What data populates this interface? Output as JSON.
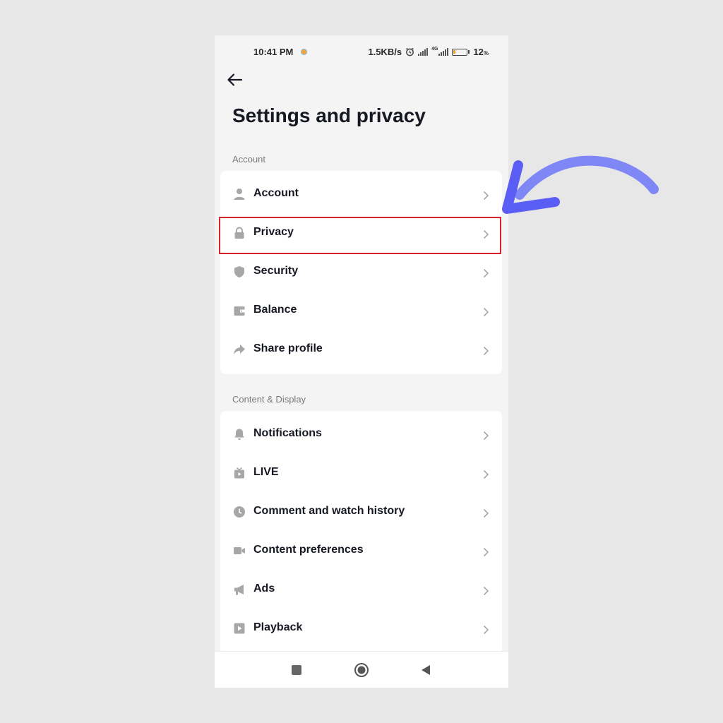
{
  "status": {
    "time": "10:41 PM",
    "speed": "1.5KB/s",
    "network": "4G",
    "battery": "12",
    "battery_unit": "%"
  },
  "header": {
    "title": "Settings and privacy"
  },
  "sections": [
    {
      "label": "Account",
      "items": [
        {
          "label": "Account",
          "icon": "person-icon"
        },
        {
          "label": "Privacy",
          "icon": "lock-icon"
        },
        {
          "label": "Security",
          "icon": "shield-icon"
        },
        {
          "label": "Balance",
          "icon": "wallet-icon"
        },
        {
          "label": "Share profile",
          "icon": "share-icon"
        }
      ]
    },
    {
      "label": "Content & Display",
      "items": [
        {
          "label": "Notifications",
          "icon": "bell-icon"
        },
        {
          "label": "LIVE",
          "icon": "live-tv-icon"
        },
        {
          "label": "Comment and watch history",
          "icon": "clock-icon"
        },
        {
          "label": "Content preferences",
          "icon": "video-camera-icon"
        },
        {
          "label": "Ads",
          "icon": "megaphone-icon"
        },
        {
          "label": "Playback",
          "icon": "play-icon"
        }
      ]
    }
  ],
  "colors": {
    "highlight": "#d9222a",
    "arrow": "#5b5ef5",
    "icon": "#a7a7a7"
  }
}
